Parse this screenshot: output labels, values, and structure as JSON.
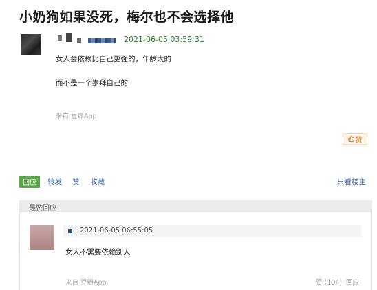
{
  "title": "小奶狗如果没死，梅尔也不会选择他",
  "post": {
    "timestamp": "2021-06-05 03:59:31",
    "lines": [
      "女人会依赖比自己更强的，年龄大的",
      "而不是一个崇拜自己的"
    ],
    "source": "来自 豆瓣App",
    "like_icon": "thumbs-up-icon",
    "like_label": "赞"
  },
  "actions": {
    "reply": "回应",
    "share": "转发",
    "like": "赞",
    "favorite": "收藏",
    "only_op": "只看楼主"
  },
  "hot_replies": {
    "header": "最赞回应",
    "items": [
      {
        "timestamp": "2021-06-05 06:55:05",
        "text": "女人不需要依赖别人",
        "source": "来自 豆瓣App",
        "likes": "赞 (104)",
        "reply_label": "回应"
      }
    ]
  },
  "colors": {
    "timestamp_green": "#2d7a2d",
    "link_blue": "#3a63a0",
    "reply_green": "#5aa64b",
    "like_orange": "#e07a2b"
  }
}
